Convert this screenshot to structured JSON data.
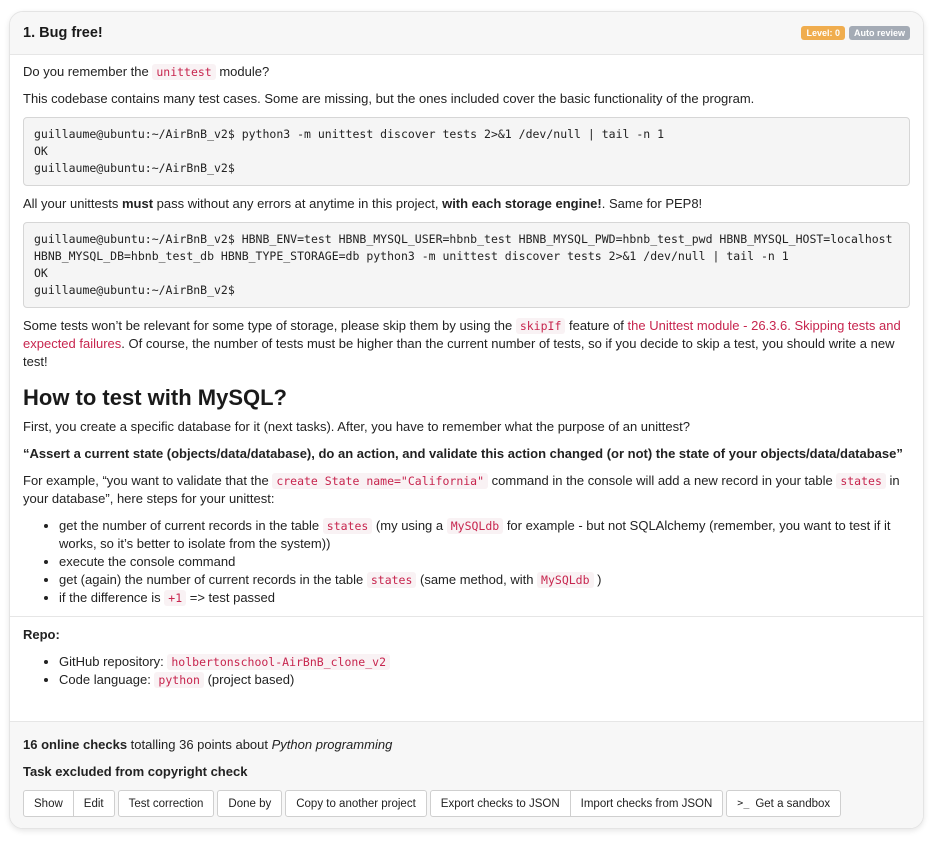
{
  "task": {
    "title": "1. Bug free!",
    "badge_level": "Level: 0",
    "badge_review": "Auto review"
  },
  "intro": {
    "p1_pre": "Do you remember the ",
    "p1_code": "unittest",
    "p1_post": " module?",
    "p2": "This codebase contains many test cases. Some are missing, but the ones included cover the basic functionality of the program.",
    "code1": "guillaume@ubuntu:~/AirBnB_v2$ python3 -m unittest discover tests 2>&1 /dev/null | tail -n 1\nOK\nguillaume@ubuntu:~/AirBnB_v2$",
    "p3_a": "All your unittests ",
    "p3_b": "must",
    "p3_c": " pass without any errors at anytime in this project, ",
    "p3_d": "with each storage engine!",
    "p3_e": ". Same for PEP8!",
    "code2": "guillaume@ubuntu:~/AirBnB_v2$ HBNB_ENV=test HBNB_MYSQL_USER=hbnb_test HBNB_MYSQL_PWD=hbnb_test_pwd HBNB_MYSQL_HOST=localhost HBNB_MYSQL_DB=hbnb_test_db HBNB_TYPE_STORAGE=db python3 -m unittest discover tests 2>&1 /dev/null | tail -n 1\nOK\nguillaume@ubuntu:~/AirBnB_v2$",
    "p4_a": "Some tests won’t be relevant for some type of storage, please skip them by using the ",
    "p4_code": "skipIf",
    "p4_b": " feature of ",
    "p4_link": "the Unittest module - 26.3.6. Skipping tests and expected failures",
    "p4_c": ". Of course, the number of tests must be higher than the current number of tests, so if you decide to skip a test, you should write a new test!"
  },
  "mysql": {
    "heading": "How to test with MySQL?",
    "p1": "First, you create a specific database for it (next tasks). After, you have to remember what the purpose of an unittest?",
    "quote": "“Assert a current state (objects/data/database), do an action, and validate this action changed (or not) the state of your objects/data/database”",
    "p2_a": "For example, “you want to validate that the ",
    "p2_code1": "create State name=\"California\"",
    "p2_b": " command in the console will add a new record in your table ",
    "p2_code2": "states",
    "p2_c": " in your database”, here steps for your unittest:",
    "li1_a": "get the number of current records in the table ",
    "li1_code1": "states",
    "li1_b": " (my using a ",
    "li1_code2": "MySQLdb",
    "li1_c": " for example - but not SQLAlchemy (remember, you want to test if it works, so it’s better to isolate from the system))",
    "li2": "execute the console command",
    "li3_a": "get (again) the number of current records in the table ",
    "li3_code1": "states",
    "li3_b": " (same method, with ",
    "li3_code2": "MySQLdb",
    "li3_c": " )",
    "li4_a": "if the difference is ",
    "li4_code": "+1",
    "li4_b": " => test passed"
  },
  "repo": {
    "title": "Repo:",
    "gh_label": "GitHub repository: ",
    "gh_value": "holbertonschool-AirBnB_clone_v2",
    "lang_label": "Code language: ",
    "lang_value": "python",
    "lang_note": " (project based)"
  },
  "footer": {
    "checks_bold": "16 online checks",
    "checks_mid": " totalling 36 points about ",
    "checks_topic": "Python programming",
    "excluded": "Task excluded from copyright check",
    "btn_show": "Show",
    "btn_edit": "Edit",
    "btn_test": "Test correction",
    "btn_done": "Done by",
    "btn_copy": "Copy to another project",
    "btn_export": "Export checks to JSON",
    "btn_import": "Import checks from JSON",
    "btn_sandbox_icon": ">_",
    "btn_sandbox": "Get a sandbox"
  }
}
